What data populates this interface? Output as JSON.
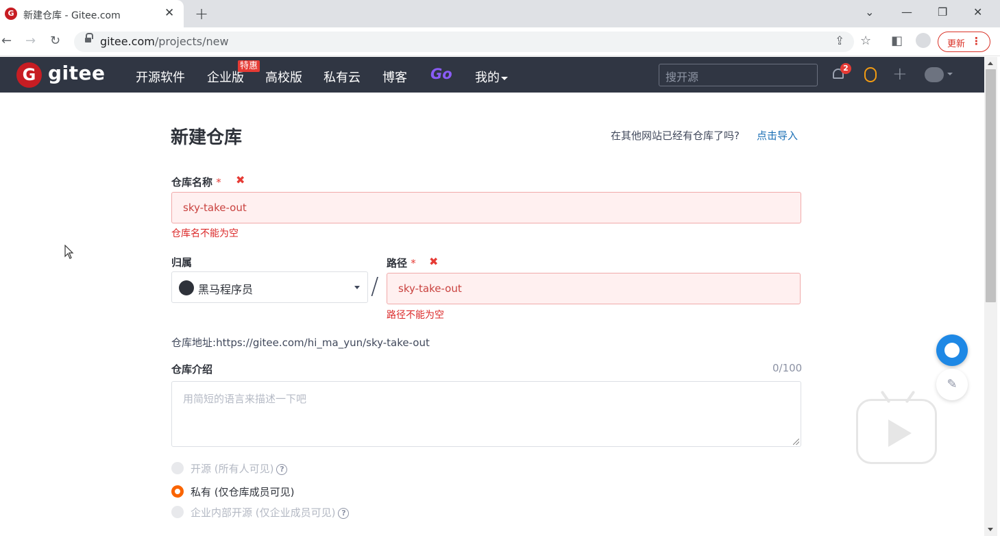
{
  "browser": {
    "tab_title": "新建仓库 - Gitee.com",
    "tab_favicon": "G",
    "url_host": "gitee.com",
    "url_path": "/projects/new",
    "update_label": "更新"
  },
  "header": {
    "logo_text": "gitee",
    "nav": [
      {
        "label": "开源软件"
      },
      {
        "label": "企业版",
        "badge": "特惠"
      },
      {
        "label": "高校版"
      },
      {
        "label": "私有云"
      },
      {
        "label": "博客"
      },
      {
        "label": "Go"
      },
      {
        "label": "我的"
      }
    ],
    "search_placeholder": "搜开源",
    "notification_count": "2"
  },
  "page": {
    "title": "新建仓库",
    "import_question": "在其他网站已经有仓库了吗?",
    "import_link": "点击导入"
  },
  "form": {
    "repo_name_label": "仓库名称",
    "required_mark": "*",
    "error_mark": "✖",
    "repo_name_value": "sky-take-out",
    "repo_name_error": "仓库名不能为空",
    "owner_label": "归属",
    "owner_value": "黑马程序员",
    "path_separator": "/",
    "path_label": "路径",
    "path_value": "sky-take-out",
    "path_error": "路径不能为空",
    "repo_url_prefix": "仓库地址:",
    "repo_url": "https://gitee.com/hi_ma_yun/sky-take-out",
    "intro_label": "仓库介绍",
    "intro_counter": "0/100",
    "intro_placeholder": "用简短的语言来描述一下吧",
    "visibility": [
      {
        "label": "开源 (所有人可见)",
        "selected": false,
        "disabled": true,
        "help": true
      },
      {
        "label": "私有 (仅仓库成员可见)",
        "selected": true,
        "disabled": false,
        "help": false
      },
      {
        "label": "企业内部开源 (仅企业成员可见)",
        "selected": false,
        "disabled": true,
        "help": true
      }
    ]
  },
  "colors": {
    "header_bg": "#303643",
    "brand_red": "#c71d23",
    "error_red": "#db2828",
    "link_blue": "#1a6fb5",
    "radio_orange": "#fa6400"
  }
}
